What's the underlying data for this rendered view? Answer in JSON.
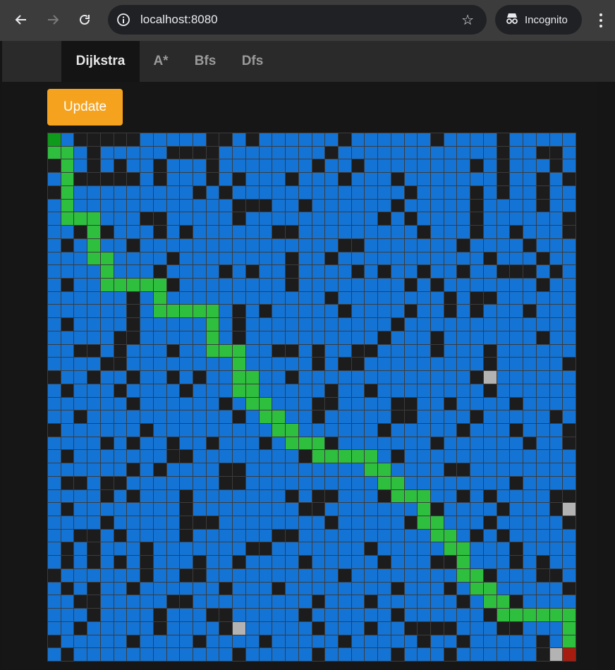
{
  "browser": {
    "url": "localhost:8080",
    "incognito_label": "Incognito"
  },
  "tabs": [
    {
      "label": "Dijkstra",
      "active": true
    },
    {
      "label": "A*",
      "active": false
    },
    {
      "label": "Bfs",
      "active": false
    },
    {
      "label": "Dfs",
      "active": false
    }
  ],
  "update_label": "Update",
  "colors": {
    "open": "#1474d6",
    "wall": "#1c1c1c",
    "path": "#2fbf3f",
    "start": "#0e9a1a",
    "end": "#a61c0e",
    "visited": "#b3b3b3",
    "accent": "#f5a31f"
  },
  "grid": {
    "rows": 40,
    "cols": 40,
    "start": [
      0,
      0
    ],
    "end": [
      39,
      39
    ],
    "path": [
      [
        1,
        0
      ],
      [
        1,
        1
      ],
      [
        2,
        1
      ],
      [
        3,
        1
      ],
      [
        4,
        1
      ],
      [
        5,
        1
      ],
      [
        6,
        1
      ],
      [
        6,
        2
      ],
      [
        6,
        3
      ],
      [
        7,
        3
      ],
      [
        8,
        3
      ],
      [
        9,
        3
      ],
      [
        9,
        4
      ],
      [
        10,
        4
      ],
      [
        11,
        4
      ],
      [
        11,
        5
      ],
      [
        11,
        6
      ],
      [
        11,
        7
      ],
      [
        11,
        8
      ],
      [
        12,
        8
      ],
      [
        13,
        8
      ],
      [
        13,
        9
      ],
      [
        13,
        10
      ],
      [
        13,
        11
      ],
      [
        13,
        12
      ],
      [
        14,
        12
      ],
      [
        15,
        12
      ],
      [
        16,
        12
      ],
      [
        16,
        13
      ],
      [
        16,
        14
      ],
      [
        17,
        14
      ],
      [
        18,
        14
      ],
      [
        19,
        14
      ],
      [
        18,
        15
      ],
      [
        19,
        15
      ],
      [
        20,
        15
      ],
      [
        20,
        16
      ],
      [
        21,
        16
      ],
      [
        21,
        17
      ],
      [
        22,
        17
      ],
      [
        22,
        18
      ],
      [
        23,
        18
      ],
      [
        23,
        19
      ],
      [
        23,
        20
      ],
      [
        24,
        20
      ],
      [
        24,
        21
      ],
      [
        24,
        22
      ],
      [
        24,
        23
      ],
      [
        24,
        24
      ],
      [
        25,
        24
      ],
      [
        25,
        25
      ],
      [
        26,
        25
      ],
      [
        26,
        26
      ],
      [
        27,
        26
      ],
      [
        27,
        27
      ],
      [
        27,
        28
      ],
      [
        28,
        28
      ],
      [
        29,
        28
      ],
      [
        29,
        29
      ],
      [
        30,
        29
      ],
      [
        30,
        30
      ],
      [
        31,
        30
      ],
      [
        31,
        31
      ],
      [
        32,
        31
      ],
      [
        33,
        31
      ],
      [
        33,
        32
      ],
      [
        34,
        32
      ],
      [
        34,
        33
      ],
      [
        35,
        33
      ],
      [
        35,
        34
      ],
      [
        36,
        34
      ],
      [
        36,
        35
      ],
      [
        36,
        36
      ],
      [
        36,
        37
      ],
      [
        36,
        38
      ],
      [
        37,
        39
      ],
      [
        38,
        39
      ],
      [
        36,
        39
      ]
    ],
    "visited": [
      [
        18,
        33
      ],
      [
        28,
        39
      ],
      [
        37,
        14
      ],
      [
        39,
        38
      ]
    ],
    "walls": [
      [
        0,
        2
      ],
      [
        0,
        3
      ],
      [
        0,
        4
      ],
      [
        0,
        5
      ],
      [
        0,
        6
      ],
      [
        0,
        12
      ],
      [
        0,
        13
      ],
      [
        0,
        15
      ],
      [
        0,
        22
      ],
      [
        0,
        29
      ],
      [
        0,
        34
      ],
      [
        1,
        3
      ],
      [
        1,
        9
      ],
      [
        1,
        10
      ],
      [
        1,
        11
      ],
      [
        1,
        12
      ],
      [
        1,
        21
      ],
      [
        1,
        34
      ],
      [
        1,
        37
      ],
      [
        1,
        38
      ],
      [
        2,
        0
      ],
      [
        2,
        3
      ],
      [
        2,
        5
      ],
      [
        2,
        8
      ],
      [
        2,
        12
      ],
      [
        2,
        20
      ],
      [
        2,
        23
      ],
      [
        2,
        32
      ],
      [
        2,
        34
      ],
      [
        2,
        38
      ],
      [
        3,
        2
      ],
      [
        3,
        3
      ],
      [
        3,
        4
      ],
      [
        3,
        5
      ],
      [
        3,
        6
      ],
      [
        3,
        8
      ],
      [
        3,
        12
      ],
      [
        3,
        14
      ],
      [
        3,
        18
      ],
      [
        3,
        22
      ],
      [
        3,
        26
      ],
      [
        3,
        34
      ],
      [
        3,
        37
      ],
      [
        3,
        39
      ],
      [
        4,
        0
      ],
      [
        4,
        11
      ],
      [
        4,
        13
      ],
      [
        4,
        27
      ],
      [
        4,
        32
      ],
      [
        4,
        34
      ],
      [
        4,
        37
      ],
      [
        5,
        14
      ],
      [
        5,
        15
      ],
      [
        5,
        16
      ],
      [
        5,
        19
      ],
      [
        5,
        26
      ],
      [
        5,
        32
      ],
      [
        5,
        37
      ],
      [
        6,
        7
      ],
      [
        6,
        8
      ],
      [
        6,
        14
      ],
      [
        6,
        25
      ],
      [
        6,
        27
      ],
      [
        6,
        32
      ],
      [
        6,
        39
      ],
      [
        7,
        2
      ],
      [
        7,
        4
      ],
      [
        7,
        8
      ],
      [
        7,
        10
      ],
      [
        7,
        17
      ],
      [
        7,
        18
      ],
      [
        7,
        28
      ],
      [
        7,
        32
      ],
      [
        7,
        35
      ],
      [
        7,
        39
      ],
      [
        8,
        1
      ],
      [
        8,
        6
      ],
      [
        8,
        22
      ],
      [
        8,
        23
      ],
      [
        8,
        31
      ],
      [
        8,
        36
      ],
      [
        9,
        9
      ],
      [
        9,
        18
      ],
      [
        9,
        21
      ],
      [
        9,
        33
      ],
      [
        9,
        37
      ],
      [
        10,
        8
      ],
      [
        10,
        13
      ],
      [
        10,
        15
      ],
      [
        10,
        18
      ],
      [
        10,
        23
      ],
      [
        10,
        25
      ],
      [
        10,
        28
      ],
      [
        10,
        31
      ],
      [
        10,
        34
      ],
      [
        10,
        35
      ],
      [
        10,
        36
      ],
      [
        10,
        38
      ],
      [
        11,
        1
      ],
      [
        11,
        9
      ],
      [
        11,
        18
      ],
      [
        11,
        27
      ],
      [
        11,
        29
      ],
      [
        11,
        37
      ],
      [
        12,
        6
      ],
      [
        12,
        21
      ],
      [
        12,
        30
      ],
      [
        12,
        32
      ],
      [
        12,
        33
      ],
      [
        13,
        6
      ],
      [
        13,
        14
      ],
      [
        13,
        16
      ],
      [
        13,
        22
      ],
      [
        13,
        27
      ],
      [
        13,
        30
      ],
      [
        13,
        32
      ],
      [
        13,
        36
      ],
      [
        14,
        1
      ],
      [
        14,
        6
      ],
      [
        14,
        14
      ],
      [
        14,
        26
      ],
      [
        15,
        5
      ],
      [
        15,
        6
      ],
      [
        15,
        14
      ],
      [
        15,
        25
      ],
      [
        15,
        29
      ],
      [
        15,
        37
      ],
      [
        16,
        2
      ],
      [
        16,
        3
      ],
      [
        16,
        5
      ],
      [
        16,
        9
      ],
      [
        16,
        17
      ],
      [
        16,
        18
      ],
      [
        16,
        20
      ],
      [
        16,
        23
      ],
      [
        16,
        24
      ],
      [
        16,
        29
      ],
      [
        16,
        33
      ],
      [
        17,
        4
      ],
      [
        17,
        5
      ],
      [
        17,
        20
      ],
      [
        17,
        22
      ],
      [
        17,
        23
      ],
      [
        17,
        33
      ],
      [
        17,
        39
      ],
      [
        18,
        0
      ],
      [
        18,
        3
      ],
      [
        18,
        6
      ],
      [
        18,
        9
      ],
      [
        18,
        11
      ],
      [
        18,
        18
      ],
      [
        18,
        32
      ],
      [
        19,
        1
      ],
      [
        19,
        5
      ],
      [
        19,
        10
      ],
      [
        19,
        15
      ],
      [
        19,
        21
      ],
      [
        19,
        24
      ],
      [
        19,
        33
      ],
      [
        20,
        6
      ],
      [
        20,
        13
      ],
      [
        20,
        20
      ],
      [
        20,
        21
      ],
      [
        20,
        26
      ],
      [
        20,
        27
      ],
      [
        20,
        30
      ],
      [
        20,
        35
      ],
      [
        21,
        2
      ],
      [
        21,
        14
      ],
      [
        21,
        17
      ],
      [
        21,
        20
      ],
      [
        21,
        26
      ],
      [
        21,
        27
      ],
      [
        21,
        32
      ],
      [
        21,
        38
      ],
      [
        22,
        0
      ],
      [
        22,
        7
      ],
      [
        22,
        17
      ],
      [
        22,
        25
      ],
      [
        22,
        31
      ],
      [
        22,
        35
      ],
      [
        22,
        39
      ],
      [
        23,
        4
      ],
      [
        23,
        6
      ],
      [
        23,
        9
      ],
      [
        23,
        12
      ],
      [
        23,
        16
      ],
      [
        23,
        21
      ],
      [
        23,
        29
      ],
      [
        23,
        36
      ],
      [
        23,
        39
      ],
      [
        24,
        1
      ],
      [
        24,
        9
      ],
      [
        24,
        10
      ],
      [
        24,
        19
      ],
      [
        24,
        26
      ],
      [
        25,
        6
      ],
      [
        25,
        8
      ],
      [
        25,
        13
      ],
      [
        25,
        14
      ],
      [
        25,
        30
      ],
      [
        25,
        31
      ],
      [
        26,
        1
      ],
      [
        26,
        2
      ],
      [
        26,
        4
      ],
      [
        26,
        5
      ],
      [
        26,
        13
      ],
      [
        26,
        14
      ],
      [
        26,
        35
      ],
      [
        27,
        4
      ],
      [
        27,
        6
      ],
      [
        27,
        10
      ],
      [
        27,
        18
      ],
      [
        27,
        20
      ],
      [
        27,
        21
      ],
      [
        27,
        25
      ],
      [
        27,
        31
      ],
      [
        27,
        33
      ],
      [
        27,
        38
      ],
      [
        27,
        39
      ],
      [
        28,
        1
      ],
      [
        28,
        10
      ],
      [
        28,
        19
      ],
      [
        28,
        20
      ],
      [
        28,
        29
      ],
      [
        28,
        34
      ],
      [
        28,
        38
      ],
      [
        29,
        4
      ],
      [
        29,
        10
      ],
      [
        29,
        11
      ],
      [
        29,
        12
      ],
      [
        29,
        21
      ],
      [
        29,
        27
      ],
      [
        29,
        33
      ],
      [
        29,
        39
      ],
      [
        30,
        2
      ],
      [
        30,
        3
      ],
      [
        30,
        5
      ],
      [
        30,
        10
      ],
      [
        30,
        17
      ],
      [
        30,
        18
      ],
      [
        30,
        32
      ],
      [
        30,
        34
      ],
      [
        31,
        1
      ],
      [
        31,
        3
      ],
      [
        31,
        7
      ],
      [
        31,
        15
      ],
      [
        31,
        16
      ],
      [
        31,
        24
      ],
      [
        31,
        35
      ],
      [
        32,
        1
      ],
      [
        32,
        3
      ],
      [
        32,
        5
      ],
      [
        32,
        7
      ],
      [
        32,
        11
      ],
      [
        32,
        14
      ],
      [
        32,
        19
      ],
      [
        32,
        25
      ],
      [
        32,
        29
      ],
      [
        32,
        30
      ],
      [
        32,
        35
      ],
      [
        32,
        37
      ],
      [
        33,
        0
      ],
      [
        33,
        7
      ],
      [
        33,
        10
      ],
      [
        33,
        11
      ],
      [
        33,
        22
      ],
      [
        33,
        33
      ],
      [
        33,
        37
      ],
      [
        33,
        38
      ],
      [
        34,
        1
      ],
      [
        34,
        3
      ],
      [
        34,
        6
      ],
      [
        34,
        13
      ],
      [
        34,
        17
      ],
      [
        34,
        26
      ],
      [
        34,
        30
      ],
      [
        34,
        39
      ],
      [
        35,
        2
      ],
      [
        35,
        3
      ],
      [
        35,
        9
      ],
      [
        35,
        10
      ],
      [
        35,
        20
      ],
      [
        35,
        24
      ],
      [
        35,
        31
      ],
      [
        35,
        35
      ],
      [
        36,
        3
      ],
      [
        36,
        8
      ],
      [
        36,
        12
      ],
      [
        36,
        13
      ],
      [
        36,
        19
      ],
      [
        36,
        26
      ],
      [
        36,
        33
      ],
      [
        37,
        2
      ],
      [
        37,
        8
      ],
      [
        37,
        13
      ],
      [
        37,
        20
      ],
      [
        37,
        24
      ],
      [
        37,
        27
      ],
      [
        37,
        28
      ],
      [
        37,
        29
      ],
      [
        37,
        30
      ],
      [
        37,
        34
      ],
      [
        37,
        35
      ],
      [
        38,
        0
      ],
      [
        38,
        6
      ],
      [
        38,
        11
      ],
      [
        38,
        16
      ],
      [
        38,
        22
      ],
      [
        38,
        28
      ],
      [
        38,
        31
      ],
      [
        38,
        37
      ],
      [
        39,
        1
      ],
      [
        39,
        14
      ],
      [
        39,
        20
      ],
      [
        39,
        26
      ],
      [
        39,
        30
      ],
      [
        39,
        37
      ]
    ]
  }
}
